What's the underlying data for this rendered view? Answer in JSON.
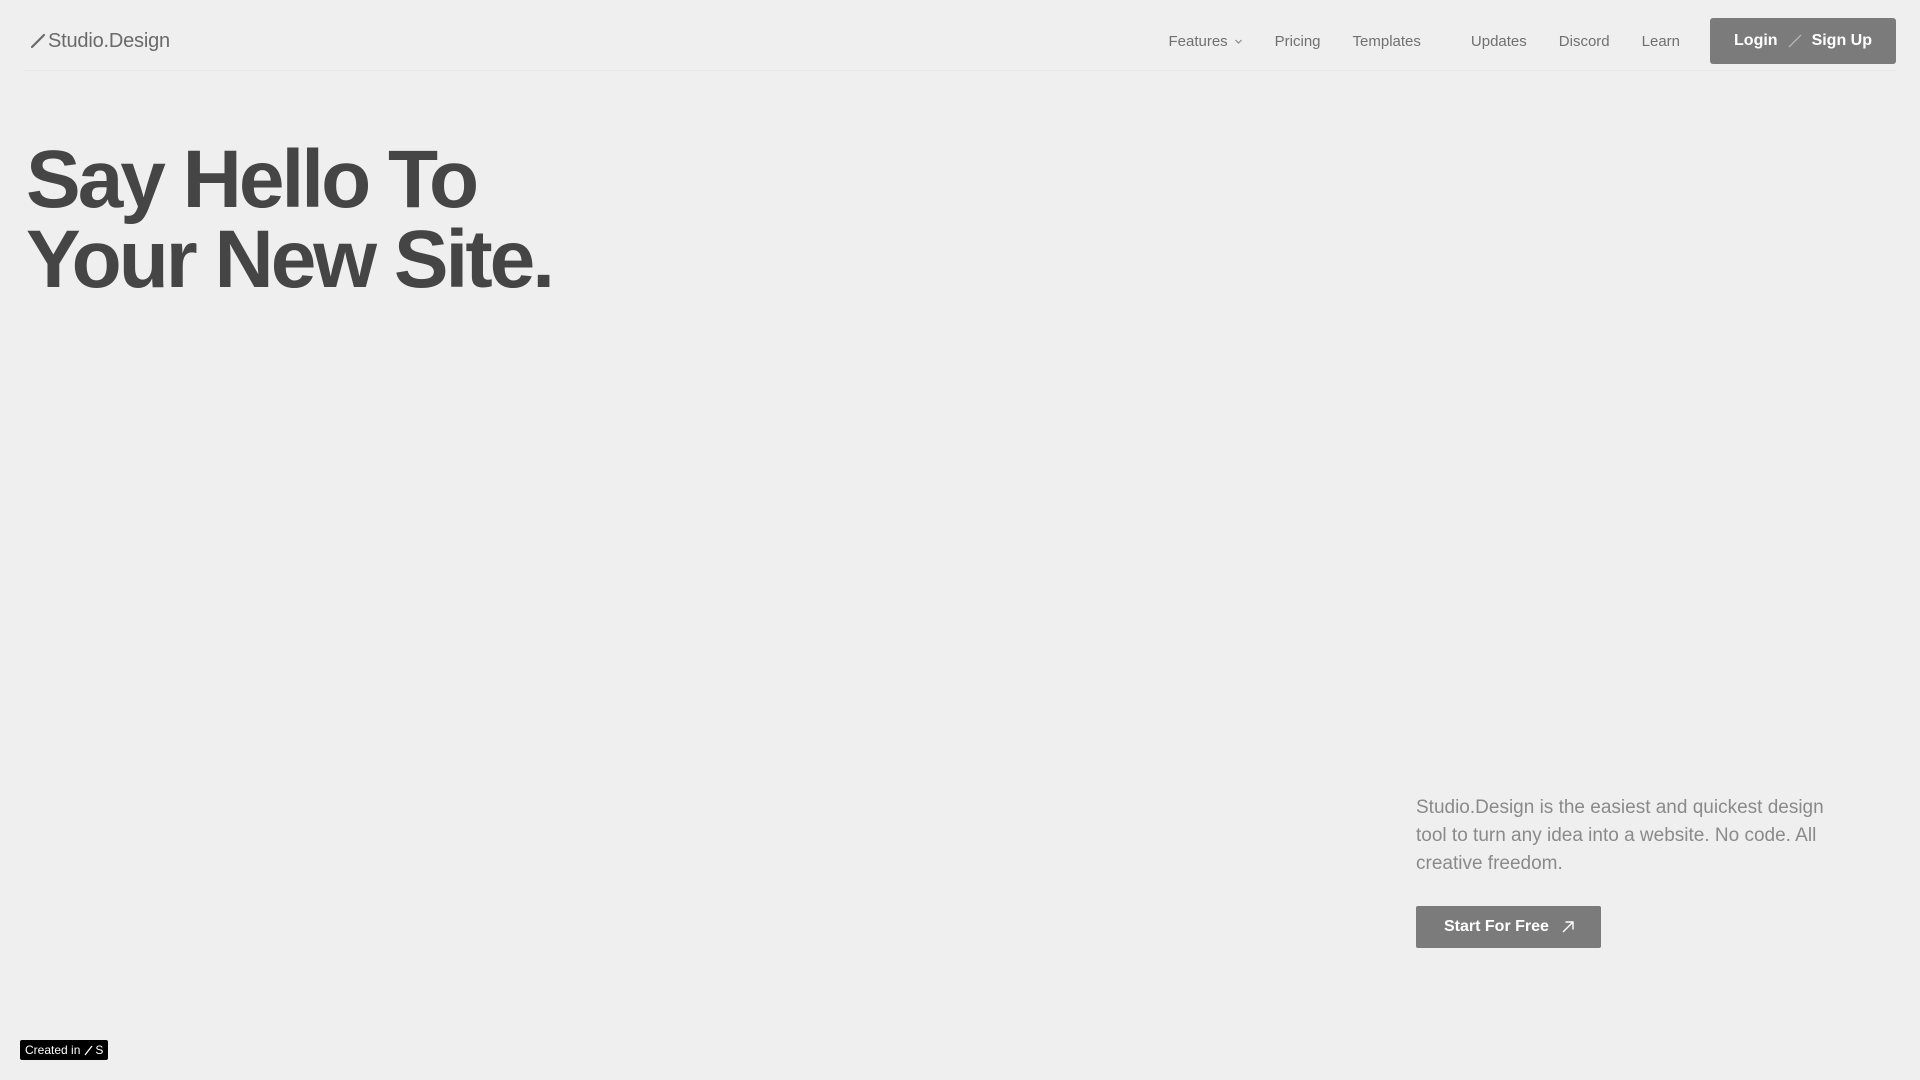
{
  "header": {
    "logo": {
      "text": "Studio.Design",
      "icon": "slash-mark-icon"
    },
    "nav": [
      {
        "label": "Features",
        "icon": "chevron-down-icon"
      },
      {
        "label": "Pricing"
      },
      {
        "label": "Templates"
      },
      {
        "label": "Updates"
      },
      {
        "label": "Discord"
      },
      {
        "label": "Learn"
      }
    ],
    "auth_button": {
      "login": "Login",
      "signup": "Sign Up",
      "separator_icon": "slash-separator-icon"
    }
  },
  "hero": {
    "title_line1": "Say Hello To",
    "title_line2": "Your New Site.",
    "description": "Studio.Design is the easiest and quickest design tool to turn any idea into a website. No code. All creative freedom.",
    "cta": {
      "label": "Start For Free",
      "icon": "arrow-up-right-icon"
    }
  },
  "badge": {
    "label": "Created in",
    "icon": "studio-logo-icon"
  },
  "colors": {
    "background": "#efefef",
    "heading": "#454545",
    "nav_text": "#707070",
    "button_bg": "#7b7b7b",
    "button_text": "#ffffff",
    "description_text": "#8a8a8a",
    "badge_bg": "#000000"
  }
}
